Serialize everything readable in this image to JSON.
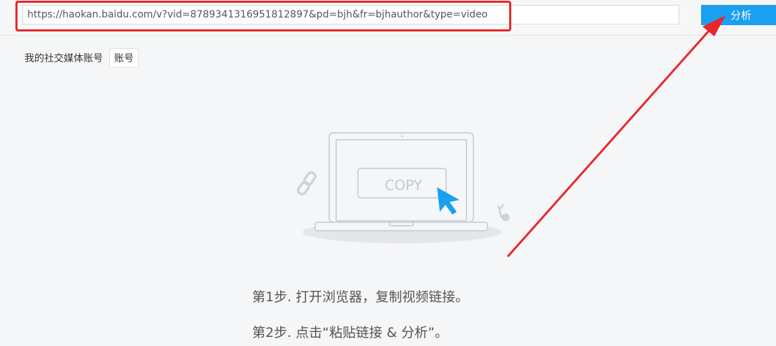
{
  "toolbar": {
    "url_value": "https://haokan.baidu.com/v?vid=8789341316951812897&pd=bjh&fr=bjhauthor&type=video",
    "analyze_label": "分析"
  },
  "social": {
    "label": "我的社交媒体账号",
    "account_button": "账号"
  },
  "illustration": {
    "copy_text": "COPY"
  },
  "steps": [
    "第1步. 打开浏览器，复制视频链接。",
    "第2步. 点击“粘贴链接 & 分析”。"
  ],
  "colors": {
    "accent": "#1b9ff0",
    "annotation_red": "#e8262a",
    "illustration_gray": "#cdd3db"
  },
  "icons": [
    "link-icon",
    "music-note-icon",
    "cursor-arrow-icon"
  ]
}
